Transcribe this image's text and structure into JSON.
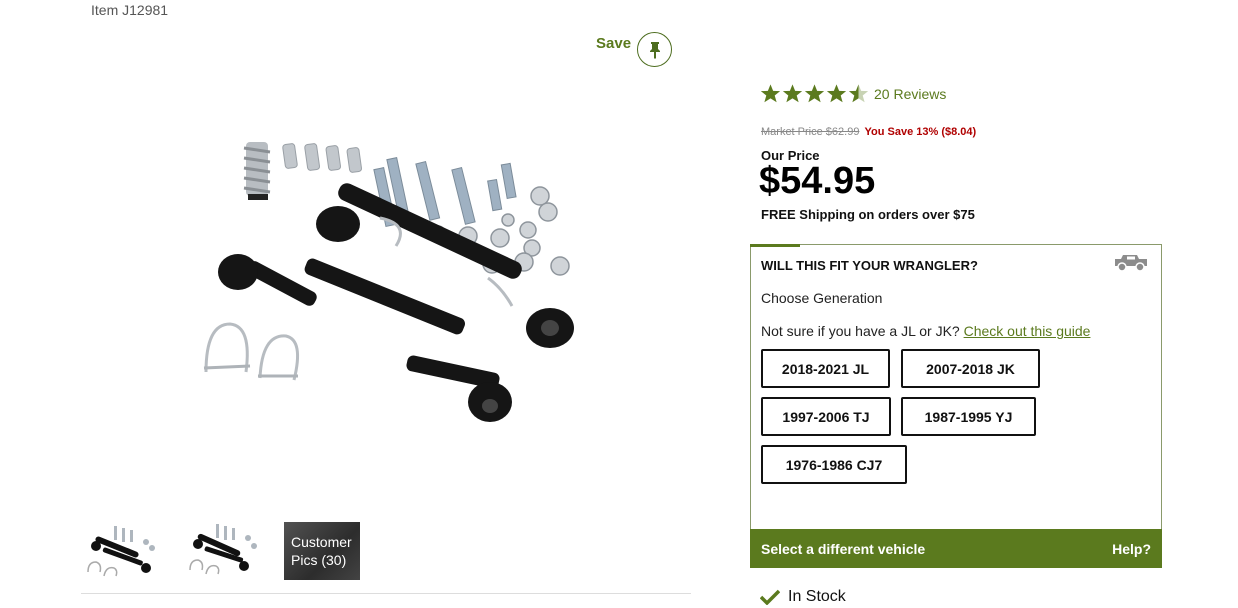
{
  "item": {
    "number": "Item J12981"
  },
  "save": {
    "label": "Save",
    "icon": "pin-icon"
  },
  "gallery": {
    "thumbnails": [
      {
        "name": "product-thumb-1"
      },
      {
        "name": "product-thumb-2"
      }
    ],
    "customer_pics_label": "Customer Pics (30)"
  },
  "rating": {
    "stars": 4.5,
    "reviews_label": "20 Reviews"
  },
  "pricing": {
    "market_price": "Market Price $62.99",
    "you_save": "You Save 13% ($8.04)",
    "our_price_label": "Our Price",
    "price": "$54.95",
    "free_shipping": "FREE Shipping on orders over $75"
  },
  "fitment": {
    "title": "WILL THIS FIT YOUR WRANGLER?",
    "choose_generation": "Choose Generation",
    "not_sure_text": "Not sure if you have a JL or JK?",
    "guide_link": "Check out this guide",
    "generations": [
      "2018-2021 JL",
      "2007-2018 JK",
      "1997-2006 TJ",
      "1987-1995 YJ",
      "1976-1986 CJ7"
    ],
    "select_different": "Select a different vehicle",
    "help": "Help?"
  },
  "stock": {
    "label": "In Stock"
  },
  "colors": {
    "accent": "#5b7a1e",
    "sale": "#b00000"
  }
}
